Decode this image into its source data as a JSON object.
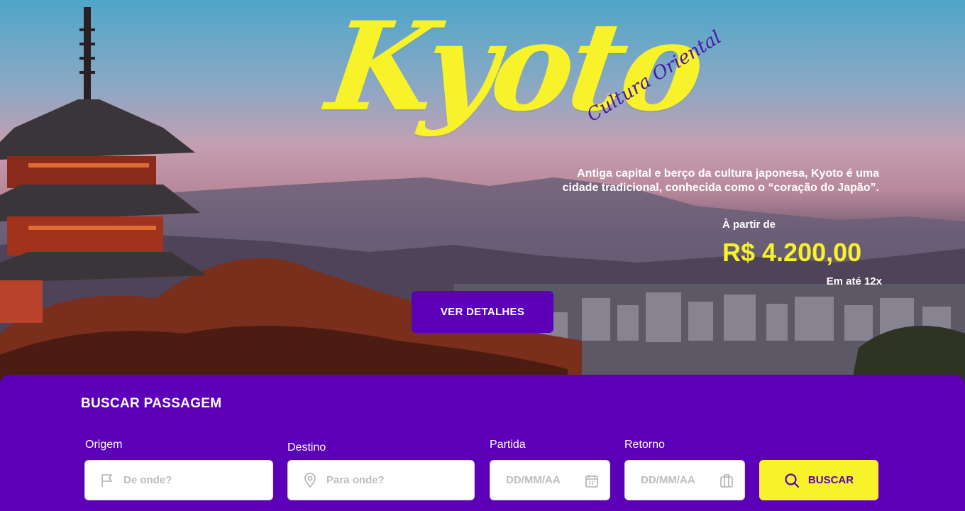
{
  "hero": {
    "title": "Kyoto",
    "subtitle": "Cultura Oriental",
    "description_line1": "Antiga capital e berço da cultura japonesa, Kyoto é uma",
    "description_line2": "cidade tradicional, conhecida como o “coração do Japão”.",
    "price_prefix": "À partir de",
    "price": "R$ 4.200,00",
    "installments": "Em até 12x",
    "details_button": "VER DETALHES"
  },
  "search": {
    "title": "BUSCAR PASSAGEM",
    "origin": {
      "label": "Origem",
      "placeholder": "De onde?",
      "icon": "flag-icon"
    },
    "destination": {
      "label": "Destino",
      "placeholder": "Para onde?",
      "icon": "map-pin-icon"
    },
    "departure": {
      "label": "Partida",
      "placeholder": "DD/MM/AA",
      "icon": "calendar-icon"
    },
    "return": {
      "label": "Retorno",
      "placeholder": "DD/MM/AA",
      "icon": "luggage-icon"
    },
    "submit_label": "BUSCAR",
    "submit_icon": "search-icon"
  },
  "colors": {
    "brand_purple": "#5b00b8",
    "accent_yellow": "#f7f22a"
  }
}
